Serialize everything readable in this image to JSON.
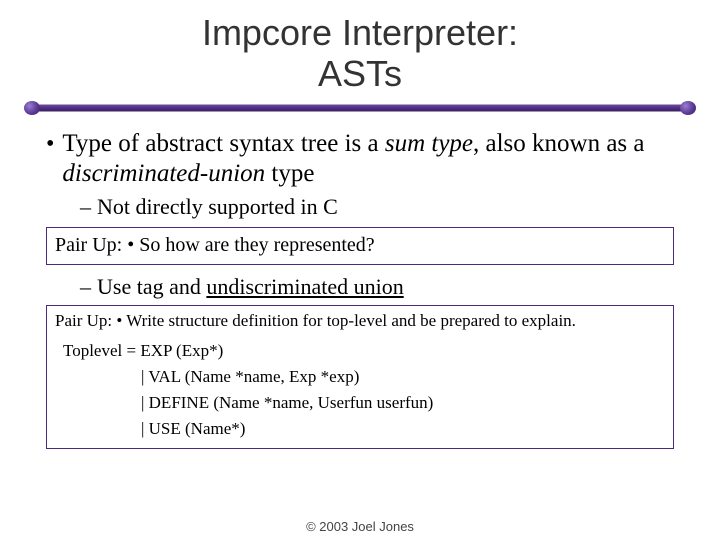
{
  "title_line1": "Impcore Interpreter:",
  "title_line2": "ASTs",
  "bullet": {
    "pre": "Type of abstract syntax tree is a ",
    "em1": "sum type",
    "mid": ", also known as a ",
    "em2": "discriminated-union",
    "post": " type"
  },
  "sub1": "Not directly supported in C",
  "pairup1": "Pair Up: • So how are they represented?",
  "sub2_pre": "Use tag and ",
  "sub2_under": "undiscriminated union",
  "pairup2": "Pair Up: • Write structure definition for top-level and be prepared to explain.",
  "grammar": {
    "l1": "Toplevel = EXP (Exp*)",
    "l2": "| VAL (Name *name, Exp *exp)",
    "l3": "| DEFINE (Name *name, Userfun userfun)",
    "l4": "| USE (Name*)"
  },
  "footer": "© 2003 Joel Jones"
}
